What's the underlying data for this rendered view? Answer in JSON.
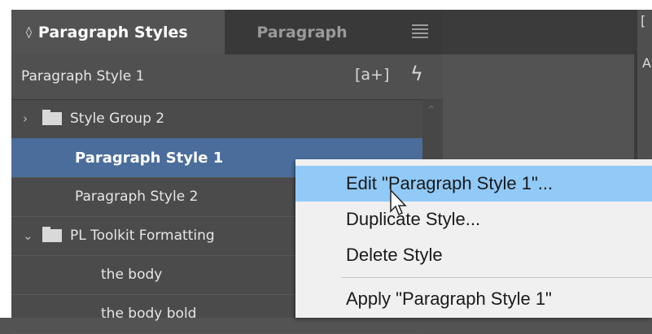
{
  "panel": {
    "active_tab": "Paragraph Styles",
    "inactive_tab": "Paragraph",
    "current_style": "Paragraph Style 1",
    "new_group_icon": "[a+]",
    "clear_overrides_icon": "lightning-icon"
  },
  "list": {
    "items": [
      {
        "label": "Style Group 2"
      },
      {
        "label": "Paragraph Style 1"
      },
      {
        "label": "Paragraph Style 2"
      },
      {
        "label": "PL Toolkit Formatting"
      },
      {
        "label": "the body"
      },
      {
        "label": "the body bold"
      }
    ]
  },
  "right": {
    "label_l": "[",
    "label_a": "A"
  },
  "context_menu": {
    "items": [
      {
        "label": "Edit \"Paragraph Style 1\"..."
      },
      {
        "label": "Duplicate Style..."
      },
      {
        "label": "Delete Style"
      },
      {
        "label": "Apply \"Paragraph Style 1\""
      }
    ]
  },
  "colors": {
    "selected_row": "#4a6d9b",
    "menu_hover": "#91c9f7"
  }
}
